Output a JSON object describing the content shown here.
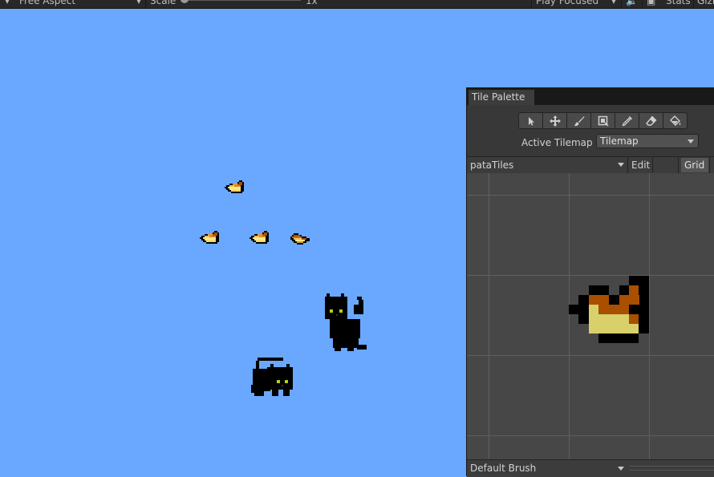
{
  "toolbar": {
    "aspect_label": "Free Aspect",
    "scale_label": "Scale",
    "scale_value": "1x",
    "play_mode_label": "Play Focused",
    "stats_label": "Stats",
    "gizmos_label": "Gizmos"
  },
  "scene": {
    "background_color": "#6aa8ff",
    "sprites": [
      "fish-tile-sprite",
      "fish-tile-sprite",
      "fish-tile-sprite",
      "fish-tile-sprite",
      "black-cat-standing",
      "black-cat-crouching"
    ]
  },
  "tile_palette": {
    "tab_title": "Tile Palette",
    "tools": [
      "select-tool-icon",
      "move-tool-icon",
      "paint-brush-icon",
      "box-fill-icon",
      "picker-icon",
      "eraser-icon",
      "flood-fill-icon"
    ],
    "active_tilemap_label": "Active Tilemap",
    "active_tilemap_value": "Tilemap",
    "palette_name": "pataTiles",
    "edit_label": "Edit",
    "grid_label": "Grid",
    "brush_label": "Default Brush"
  }
}
